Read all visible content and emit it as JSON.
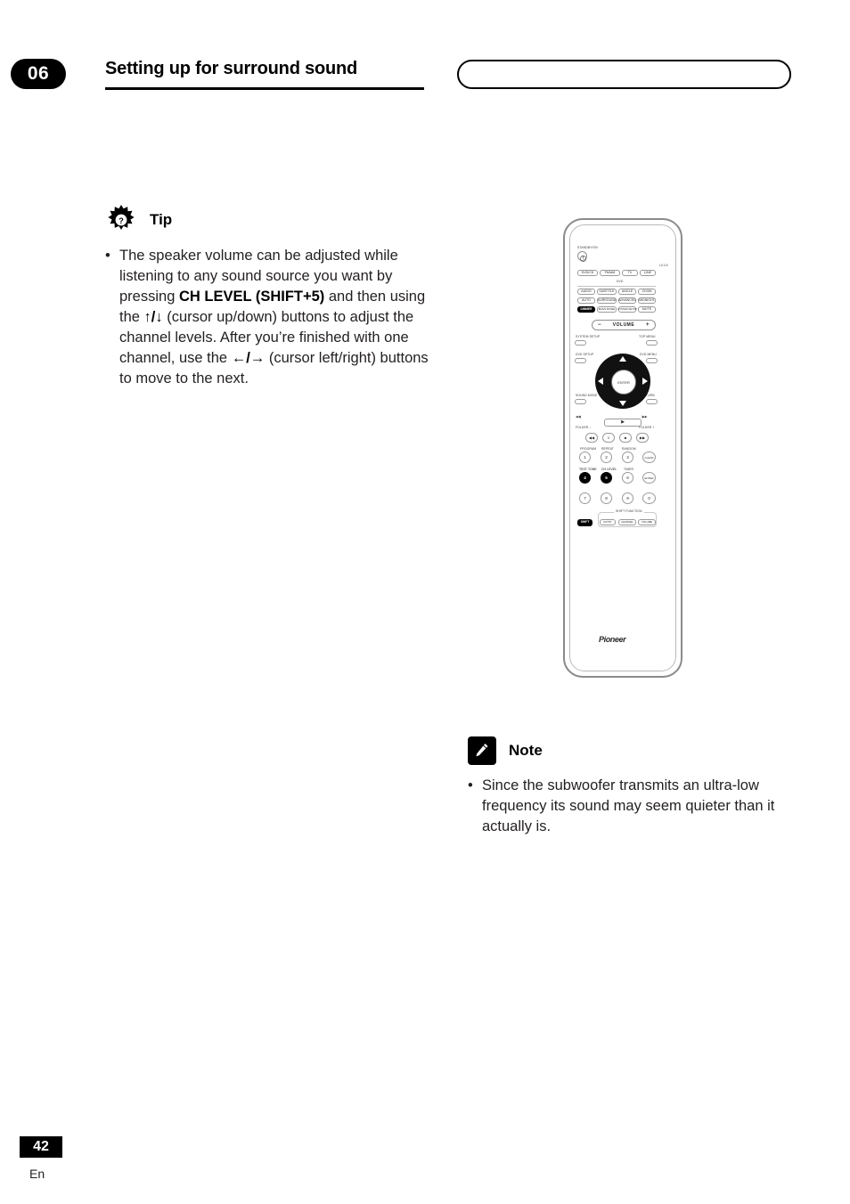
{
  "header": {
    "chapter_number": "06",
    "chapter_title": "Setting up for surround sound"
  },
  "tip": {
    "label": "Tip",
    "icon": "tip-sun-icon",
    "items": [
      {
        "part1": "The speaker volume can be adjusted while listening to any sound source you want by pressing ",
        "bold1": "CH LEVEL (SHIFT+5)",
        "part2": " and then using the ",
        "glyph1": "↑/↓",
        "part3": " (cursor up/down) buttons to adjust the channel levels. After you’re finished with one channel, use the ",
        "glyph2": "←/→",
        "part4": " (cursor left/right) buttons to move to the next."
      }
    ]
  },
  "note": {
    "label": "Note",
    "icon": "note-pencil-icon",
    "items": [
      "Since the subwoofer transmits an ultra-low frequency its sound may seem quieter than it actually is."
    ]
  },
  "footer": {
    "page_number": "42",
    "language": "En"
  },
  "remote": {
    "brand": "Pioneer",
    "labels": {
      "standby": "STANDBY/ON",
      "lv": "LV.1/2",
      "dvd_section": "DVD",
      "volume": "VOLUME",
      "enter": "ENTER",
      "system_setup": "SYSTEM SETUP",
      "top_menu": "TOP MENU",
      "dvd_setup": "DVD SETUP",
      "dvd_menu": "DVD MENU",
      "sound_mode": "SOUND MODE",
      "return": "RETURN",
      "folder_minus": "FOLDER –",
      "folder_plus": "FOLDER +",
      "program": "PROGRAM",
      "repeat": "REPEAT",
      "random": "RANDOM",
      "test_tone": "TEST TONE",
      "ch_level": "CH LEVEL",
      "timer": "TIMER",
      "clear": "CLEAR",
      "enter_num": "ENTER",
      "shift_row": "SHIFT FUNCTION",
      "shift": "SHIFT",
      "in_tst": "IN/TST",
      "channel": "CHANNEL",
      "volume_small": "VOLUME"
    },
    "source_buttons": [
      "DVD/CD",
      "FM/AM",
      "TV",
      "LINE"
    ],
    "dvd_row1": [
      "AUDIO",
      "SUBTITLE",
      "ANGLE",
      "ZOOM"
    ],
    "dvd_row2": [
      "AUTO",
      "SURROUND",
      "ADVANCED",
      "MIDNIGHT"
    ],
    "dvd_row3": [
      "DIMMER",
      "BASS MODE",
      "SYSTEM SETUP",
      "MUTE"
    ],
    "transport_top": [
      "◀◀|",
      "|▶▶"
    ],
    "transport": [
      "◀◀",
      "‖",
      "■",
      "▶▶"
    ],
    "numbers": [
      "1",
      "2",
      "3",
      "CLEAR",
      "4",
      "5",
      "6",
      "ENTER",
      "7",
      "8",
      "9",
      "0"
    ],
    "highlighted_numbers": [
      "4",
      "5"
    ],
    "shift_row_buttons": [
      "SHIFT",
      "IN/TST",
      "CHANNEL",
      "VOLUME"
    ]
  }
}
